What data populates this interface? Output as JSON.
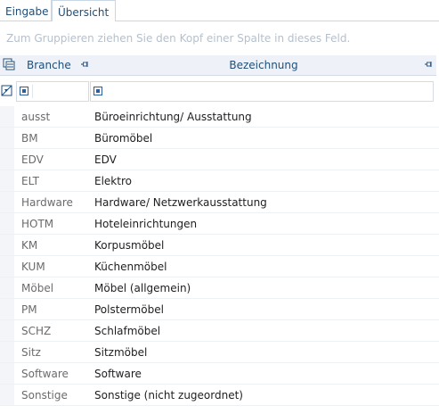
{
  "tabs": [
    {
      "label": "Eingabe",
      "active": false
    },
    {
      "label": "Übersicht",
      "active": true
    }
  ],
  "group_panel": {
    "hint": "Zum Gruppieren ziehen Sie den Kopf einer Spalte in dieses Feld."
  },
  "columns": [
    {
      "label": "Branche"
    },
    {
      "label": "Bezeichnung"
    }
  ],
  "rows": [
    {
      "code": "ausst",
      "desc": "Büroeinrichtung/ Ausstattung"
    },
    {
      "code": "BM",
      "desc": "Büromöbel"
    },
    {
      "code": "EDV",
      "desc": "EDV"
    },
    {
      "code": "ELT",
      "desc": "Elektro"
    },
    {
      "code": "Hardware",
      "desc": "Hardware/ Netzwerkausstattung"
    },
    {
      "code": "HOTM",
      "desc": "Hoteleinrichtungen"
    },
    {
      "code": "KM",
      "desc": "Korpusmöbel"
    },
    {
      "code": "KUM",
      "desc": "Küchenmöbel"
    },
    {
      "code": "Möbel",
      "desc": "Möbel (allgemein)"
    },
    {
      "code": "PM",
      "desc": "Polstermöbel"
    },
    {
      "code": "SCHZ",
      "desc": "Schlafmöbel"
    },
    {
      "code": "Sitz",
      "desc": "Sitzmöbel"
    },
    {
      "code": "Software",
      "desc": "Software"
    },
    {
      "code": "Sonstige",
      "desc": "Sonstige (nicht zugeordnet)"
    }
  ],
  "colors": {
    "header_text": "#1f4e79",
    "accent": "#2d5f9a"
  }
}
